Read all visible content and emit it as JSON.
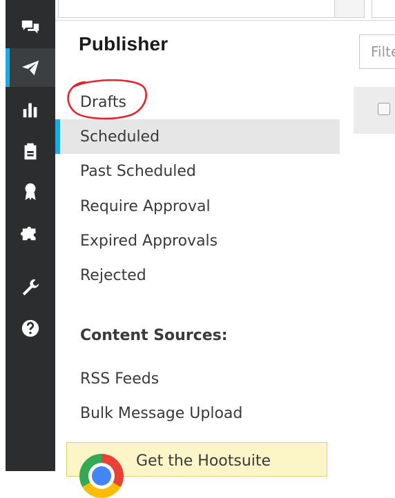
{
  "rail": {
    "items": [
      {
        "icon": "conversations-icon",
        "active": false
      },
      {
        "icon": "paper-plane-icon",
        "active": true
      },
      {
        "icon": "bar-chart-icon",
        "active": false
      },
      {
        "icon": "clipboard-icon",
        "active": false
      },
      {
        "icon": "award-ribbon-icon",
        "active": false
      },
      {
        "icon": "puzzle-piece-icon",
        "active": false
      },
      {
        "icon": "wrench-icon",
        "active": false
      },
      {
        "icon": "help-icon",
        "active": false
      }
    ],
    "accent": "#1da9e6"
  },
  "publisher": {
    "title": "Publisher",
    "items": [
      {
        "label": "Drafts"
      },
      {
        "label": "Scheduled"
      },
      {
        "label": "Past Scheduled"
      },
      {
        "label": "Require Approval"
      },
      {
        "label": "Expired Approvals"
      },
      {
        "label": "Rejected"
      }
    ],
    "selected": "Scheduled",
    "annotation_color": "#e0262d"
  },
  "content_sources": {
    "heading": "Content Sources:",
    "items": [
      {
        "label": "RSS Feeds"
      },
      {
        "label": "Bulk Message Upload"
      }
    ]
  },
  "filter": {
    "placeholder": "Filte"
  },
  "promo": {
    "text": "Get the Hootsuite"
  }
}
